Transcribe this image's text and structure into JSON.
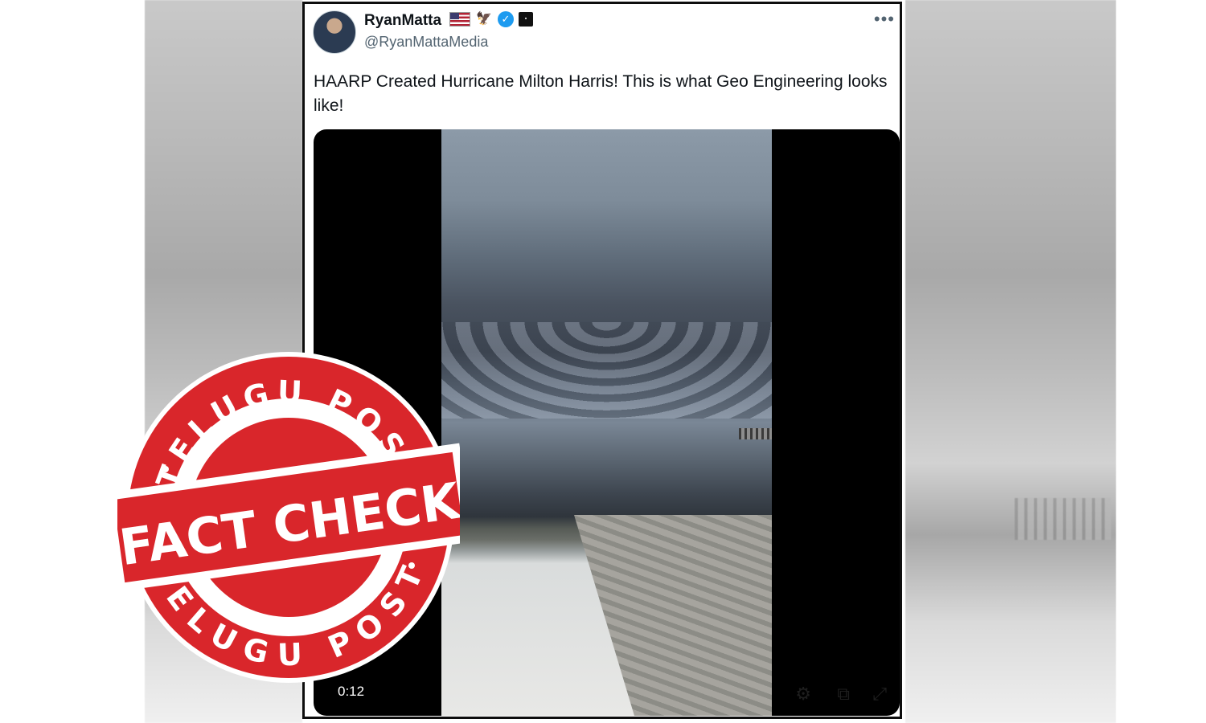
{
  "tweet": {
    "author_name": "RyanMatta",
    "author_handle": "@RyanMattaMedia",
    "text": "HAARP Created Hurricane Milton Harris! This is what Geo Engineering looks like!",
    "badges": [
      "flag-icon",
      "eagle-icon",
      "verified-icon",
      "org-icon"
    ]
  },
  "video": {
    "timestamp": "0:12",
    "controls": [
      "gear-icon",
      "popout-icon",
      "expand-icon"
    ]
  },
  "stamp": {
    "top_text": "TELUGU POST",
    "banner_text": "FACT CHECK",
    "bottom_text": "TELUGU POST",
    "color": "#d9262b"
  },
  "colors": {
    "verified": "#1d9bf0",
    "handle": "#536471",
    "text": "#0f1419"
  }
}
